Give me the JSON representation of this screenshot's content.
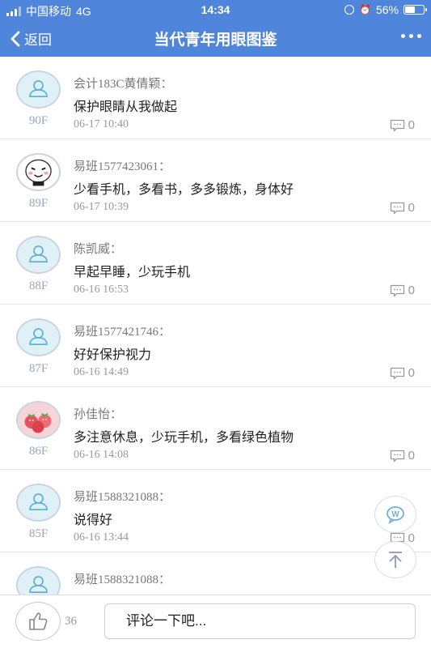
{
  "status_bar": {
    "carrier": "中国移动",
    "network": "4G",
    "time": "14:34",
    "battery": "56%",
    "battery_level": 0.56
  },
  "nav": {
    "back_label": "返回",
    "title": "当代青年用眼图鉴"
  },
  "comments": [
    {
      "author": "会计183C黄倩颖：",
      "content": "保护眼睛从我做起",
      "time": "06-17 10:40",
      "floor": "90F",
      "replies": "0",
      "avatar": "default"
    },
    {
      "author": "易班1577423061：",
      "content": "少看手机，多看书，多多锻炼，身体好",
      "time": "06-17 10:39",
      "floor": "89F",
      "replies": "0",
      "avatar": "cartoon"
    },
    {
      "author": "陈凯威：",
      "content": "早起早睡，少玩手机",
      "time": "06-16 16:53",
      "floor": "88F",
      "replies": "0",
      "avatar": "default"
    },
    {
      "author": "易班1577421746：",
      "content": "好好保护视力",
      "time": "06-16 14:49",
      "floor": "87F",
      "replies": "0",
      "avatar": "default"
    },
    {
      "author": "孙佳怡：",
      "content": "多注意休息，少玩手机，多看绿色植物",
      "time": "06-16 14:08",
      "floor": "86F",
      "replies": "0",
      "avatar": "strawberry"
    },
    {
      "author": "易班1588321088：",
      "content": "说得好",
      "time": "06-16 13:44",
      "floor": "85F",
      "replies": "0",
      "avatar": "default"
    },
    {
      "author": "易班1588321088：",
      "content": "",
      "time": "",
      "floor": "",
      "replies": "",
      "avatar": "default"
    }
  ],
  "bottom_bar": {
    "like_count": "36",
    "comment_placeholder": "评论一下吧..."
  },
  "colors": {
    "header": "#4f86dc",
    "floor_text": "#9aa6bf",
    "avatar_bg": "#dff1f7",
    "avatar_icon": "#5aaed6"
  }
}
